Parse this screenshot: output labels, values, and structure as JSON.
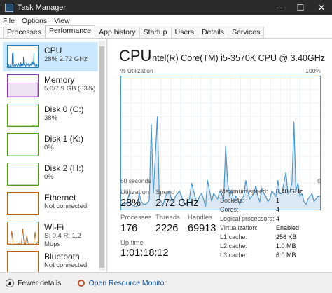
{
  "window": {
    "title": "Task Manager",
    "minimize_glyph": "─",
    "maximize_glyph": "☐",
    "close_glyph": "✕"
  },
  "menu": [
    "File",
    "Options",
    "View"
  ],
  "tabs": [
    "Processes",
    "Performance",
    "App history",
    "Startup",
    "Users",
    "Details",
    "Services"
  ],
  "sidebar": {
    "items": [
      {
        "name": "CPU",
        "sub": "28%  2.72 GHz",
        "color": "#1e7dc4",
        "selected": true
      },
      {
        "name": "Memory",
        "sub": "5.0/7.9 GB (63%)",
        "color": "#8e3bad",
        "selected": false
      },
      {
        "name": "Disk 0 (C:)",
        "sub": "38%",
        "color": "#4a9e1a",
        "selected": false
      },
      {
        "name": "Disk 1 (K:)",
        "sub": "0%",
        "color": "#4a9e1a",
        "selected": false
      },
      {
        "name": "Disk 2 (H:)",
        "sub": "0%",
        "color": "#4a9e1a",
        "selected": false
      },
      {
        "name": "Ethernet",
        "sub": "Not connected",
        "color": "#b5651d",
        "selected": false
      },
      {
        "name": "Wi-Fi",
        "sub": "S: 0.4  R: 1.2 Mbps",
        "color": "#b5651d",
        "selected": false
      },
      {
        "name": "Bluetooth",
        "sub": "Not connected",
        "color": "#b5651d",
        "selected": false
      }
    ]
  },
  "cpu": {
    "title": "CPU",
    "model": "Intel(R) Core(TM) i5-3570K CPU @ 3.40GHz",
    "utilization_label": "% Utilization",
    "max_label": "100%",
    "time_left": "60 seconds",
    "time_right": "0",
    "utilization_history": [
      3,
      5,
      4,
      6,
      12,
      4,
      3,
      2,
      3,
      12,
      6,
      4,
      4,
      5,
      7,
      64,
      12,
      40,
      70,
      8,
      6,
      4,
      10,
      12,
      14,
      8,
      6,
      10,
      12,
      14,
      10,
      6,
      4,
      6,
      8,
      20,
      14,
      8,
      6,
      10,
      12,
      8,
      2,
      22,
      14,
      6,
      12,
      10,
      8,
      14,
      12,
      6,
      48,
      20,
      10,
      14,
      6,
      10,
      8,
      4,
      8,
      10,
      22,
      14,
      8,
      10,
      12,
      18,
      10,
      6,
      16,
      12,
      10,
      6,
      8,
      14,
      12,
      10,
      22,
      12,
      12,
      20,
      28,
      12,
      14,
      20,
      66,
      14,
      20,
      10,
      12,
      6,
      4,
      8,
      10,
      12,
      6,
      8,
      10,
      10
    ],
    "line_color": "#4d94c8",
    "fill_color": "#dbe9f6",
    "stats": {
      "utilization_label": "Utilization",
      "utilization": "28%",
      "speed_label": "Speed",
      "speed": "2.72 GHz",
      "processes_label": "Processes",
      "processes": "176",
      "threads_label": "Threads",
      "threads": "2226",
      "handles_label": "Handles",
      "handles": "69913",
      "uptime_label": "Up time",
      "uptime": "1:01:18:12"
    },
    "details": [
      {
        "label": "Maximum speed:",
        "value": "3.40 GHz"
      },
      {
        "label": "Sockets:",
        "value": "1"
      },
      {
        "label": "Cores:",
        "value": "4"
      },
      {
        "label": "Logical processors:",
        "value": "4"
      },
      {
        "label": "Virtualization:",
        "value": "Enabled"
      },
      {
        "label": "L1 cache:",
        "value": "256 KB"
      },
      {
        "label": "L2 cache:",
        "value": "1.0 MB"
      },
      {
        "label": "L3 cache:",
        "value": "6.0 MB"
      }
    ]
  },
  "footer": {
    "fewer_details": "Fewer details",
    "open_monitor": "Open Resource Monitor"
  }
}
